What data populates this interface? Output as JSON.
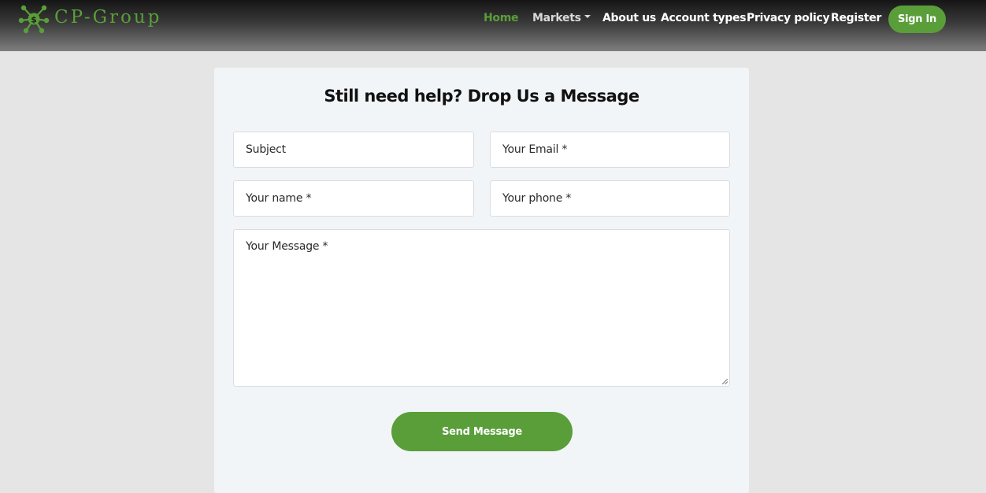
{
  "brand": {
    "name": "CP-Group",
    "logo_icon": "molecule-dollar-icon",
    "color": "#5a9e3a"
  },
  "nav": {
    "home": "Home",
    "markets": "Markets",
    "about": "About us",
    "account_types": "Account types",
    "privacy": "Privacy policy",
    "register": "Register",
    "signin": "Sign In"
  },
  "form": {
    "title": "Still need help? Drop Us a Message",
    "subject_placeholder": "Subject",
    "email_placeholder": "Your Email *",
    "name_placeholder": "Your name *",
    "phone_placeholder": "Your phone *",
    "message_placeholder": "Your Message *",
    "submit_label": "Send Message"
  },
  "colors": {
    "accent": "#5a9e3a",
    "page_bg": "#e5e5e5",
    "card_bg": "#f2f5f8"
  }
}
